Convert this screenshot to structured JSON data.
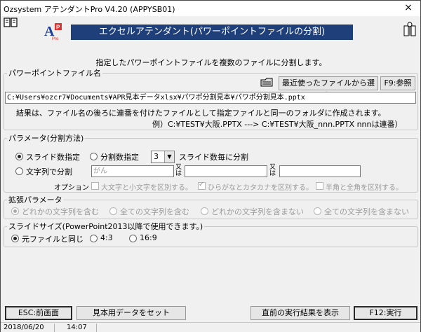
{
  "window": {
    "title": "Ozsystem アテンダントPro V4.20 (APPYSB01)",
    "close": "×"
  },
  "header": {
    "banner": "エクセルアテンダント(パワーポイントファイルの分割)",
    "logo_letter": "A",
    "logo_badge": "P",
    "logo_sub": "Pro"
  },
  "description": "指定したパワーポイントファイルを複数のファイルに分割します。",
  "file_section": {
    "legend": "パワーポイントファイル名",
    "recent_button": "最近使ったファイルから選択",
    "browse_button": "F9:参照",
    "path": "C:¥Users¥ozcr7¥Documents¥APR見本データxlsx¥パワポ分割見本¥パワポ分割見本.pptx",
    "note": "結果は、ファイル名の後ろに連番を付けたファイルとして指定ファイルと同一のフォルダに作成されます。",
    "example": "例）C:¥TEST¥大阪.PPTX ---> C:¥TEST¥大阪_nnn.PPTX  nnnは連番）"
  },
  "params": {
    "legend": "パラメータ(分割方法)",
    "radio_slide": "スライド数指定",
    "radio_split": "分割数指定",
    "slide_count": "3",
    "per_slide": "スライド数毎に分割",
    "radio_text": "文字列で分割",
    "text1": "がん",
    "or1": "又は",
    "text2": "",
    "or2": "又は",
    "text3": "",
    "options_label": "オプション",
    "opt_case": "大文字と小文字を区別する。",
    "opt_kana": "ひらがなとカタカナを区別する。",
    "opt_width": "半角と全角を区別する。"
  },
  "extended": {
    "legend": "拡張パラメータ",
    "opt_any": "どれかの文字列を含む",
    "opt_all": "全ての文字列を含む",
    "opt_not_any": "どれかの文字列を含まない",
    "opt_not_all": "全ての文字列を含まない"
  },
  "slide_size": {
    "legend": "スライドサイズ(PowerPoint2013以降で使用できます。)",
    "original": "元ファイルと同じ",
    "r43": "4:3",
    "r169": "16:9"
  },
  "footer": {
    "esc_button": "ESC:前画面",
    "sample_button": "見本用データをセット",
    "prev_result_button": "直前の実行結果を表示",
    "run_button": "F12:実行"
  },
  "status": {
    "date": "2018/06/20",
    "time": "14:07"
  }
}
